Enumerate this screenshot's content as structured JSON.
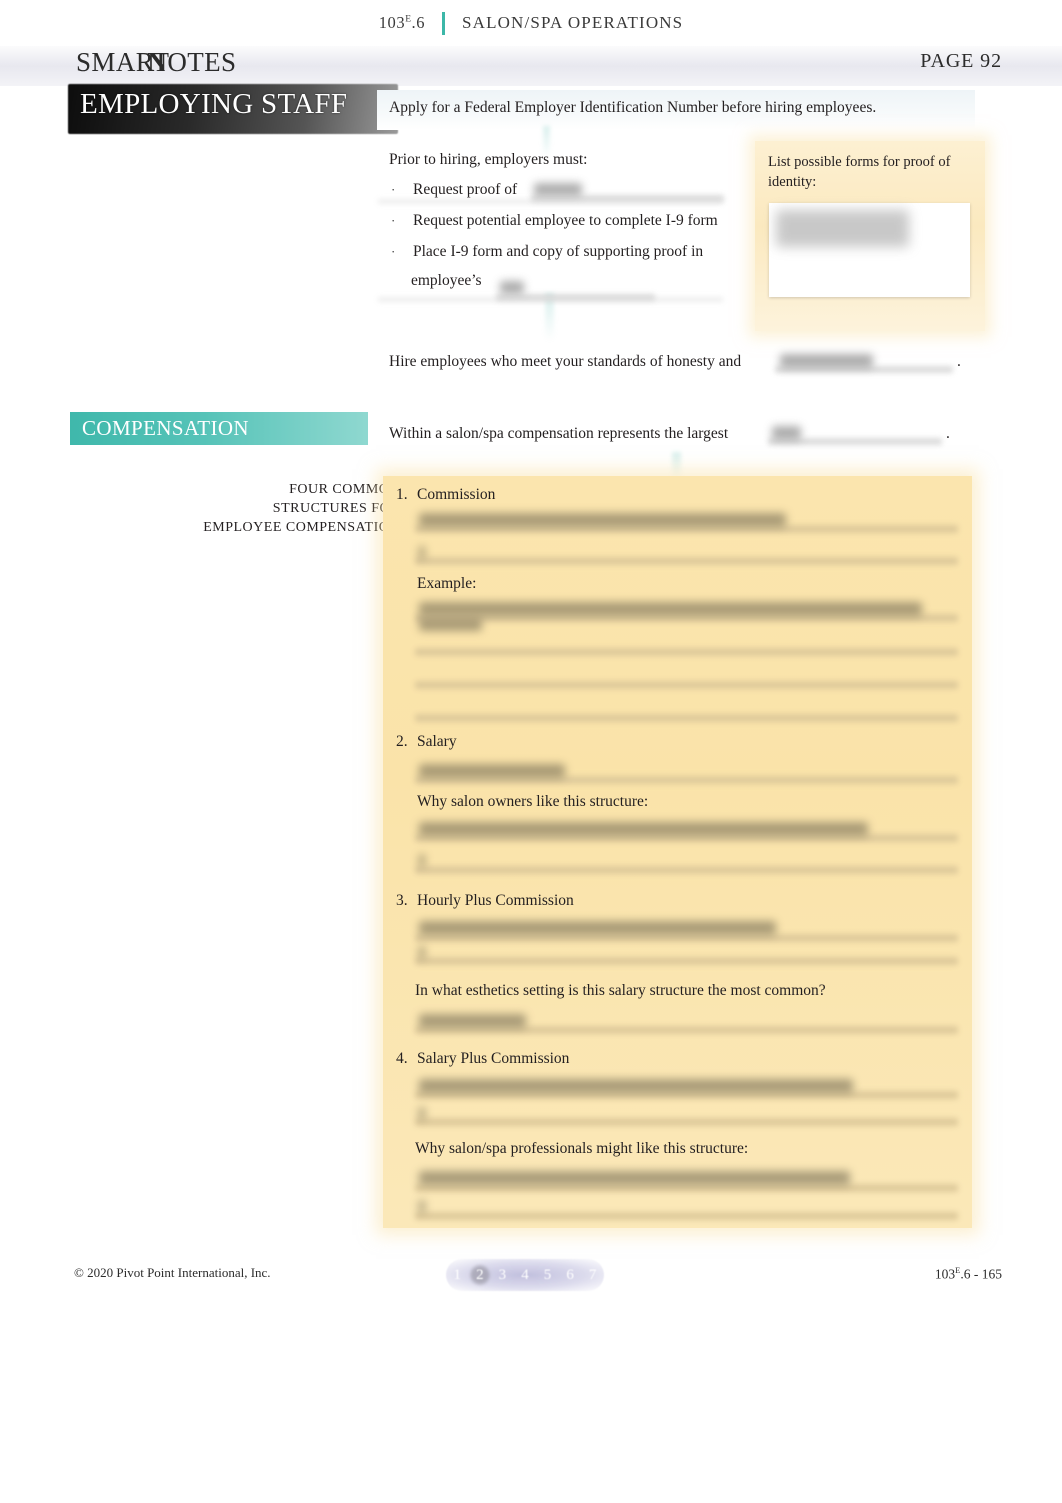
{
  "header": {
    "course_code": "103",
    "course_sup": "E",
    "course_suffix": ".6",
    "course_title": "SALON/SPA OPERATIONS",
    "wordmark_a": "SMART",
    "wordmark_b": "N",
    "wordmark_c": "OTES",
    "page_label": "PAGE 92"
  },
  "topic": {
    "banner_title": "EMPLOYING STAFF"
  },
  "intro": {
    "text": "Apply for a Federal Employer Identification Number before hiring employees."
  },
  "prior": {
    "heading": "Prior to hiring, employers must:",
    "bullets": [
      {
        "marker": "·",
        "text": "Request proof of"
      },
      {
        "marker": "·",
        "text": "Request potential employee to complete I-9 form"
      },
      {
        "marker": "·",
        "text": "Place I-9 form and copy of supporting proof in"
      }
    ],
    "bullet3_continuation": "employee’s"
  },
  "side_box": {
    "label": "List possible forms for proof of identity:"
  },
  "hire": {
    "text": "Hire employees who meet your standards of honesty and",
    "period": "."
  },
  "compensation": {
    "banner_title": "COMPENSATION",
    "lead_text": "Within a salon/spa compensation represents the largest",
    "period": ".",
    "left_caption_line1": "FOUR COMMON",
    "left_caption_line2": "STRUCTURES FOR",
    "left_caption_line3": "EMPLOYEE COMPENSATION"
  },
  "structures": [
    {
      "num": "1.",
      "label": "Commission",
      "sub_label": "Example:"
    },
    {
      "num": "2.",
      "label": "Salary",
      "sub_label": "Why salon owners like this structure:"
    },
    {
      "num": "3.",
      "label": "Hourly Plus Commission",
      "sub_label": "In what esthetics setting is this salary structure the most common?"
    },
    {
      "num": "4.",
      "label": "Salary Plus Commission",
      "sub_label": "Why salon/spa professionals might like this structure:"
    }
  ],
  "footer": {
    "copyright": "© 2020 Pivot Point International, Inc.",
    "pages": [
      "1",
      "2",
      "3",
      "4",
      "5",
      "6",
      "7"
    ],
    "active_page": "2",
    "doc_code": "103",
    "doc_sup": "E",
    "doc_code_suffix": ".6 - 165"
  },
  "colors": {
    "teal": "#3cb7a8",
    "yellow_box": "#fae3a9",
    "cream_box": "#fbe9bf",
    "pager": "#bebcdc",
    "dark_banner": "#0d0d0d"
  }
}
